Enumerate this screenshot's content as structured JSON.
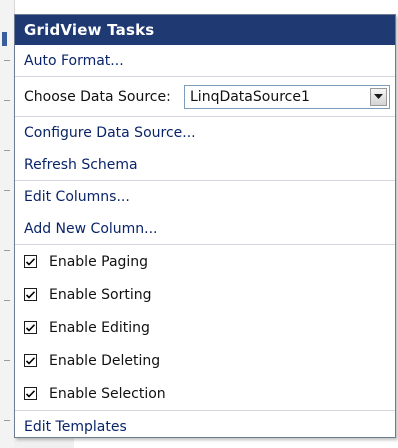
{
  "panel": {
    "title": "GridView Tasks"
  },
  "actions": {
    "auto_format": "Auto Format...",
    "configure_data_source": "Configure Data Source...",
    "refresh_schema": "Refresh Schema",
    "edit_columns": "Edit Columns...",
    "add_new_column": "Add New Column...",
    "edit_templates": "Edit Templates"
  },
  "data_source": {
    "label": "Choose Data Source:",
    "selected": "LinqDataSource1"
  },
  "options": [
    {
      "label": "Enable Paging",
      "checked": true
    },
    {
      "label": "Enable Sorting",
      "checked": true
    },
    {
      "label": "Enable Editing",
      "checked": true
    },
    {
      "label": "Enable Deleting",
      "checked": true
    },
    {
      "label": "Enable Selection",
      "checked": true
    }
  ],
  "colors": {
    "header_bg": "#1f3a73",
    "header_text": "#ffffff",
    "link_text": "#0a246a",
    "border": "#6f7d93"
  },
  "icons": {
    "dropdown": "chevron-down-icon",
    "check": "check-icon"
  }
}
